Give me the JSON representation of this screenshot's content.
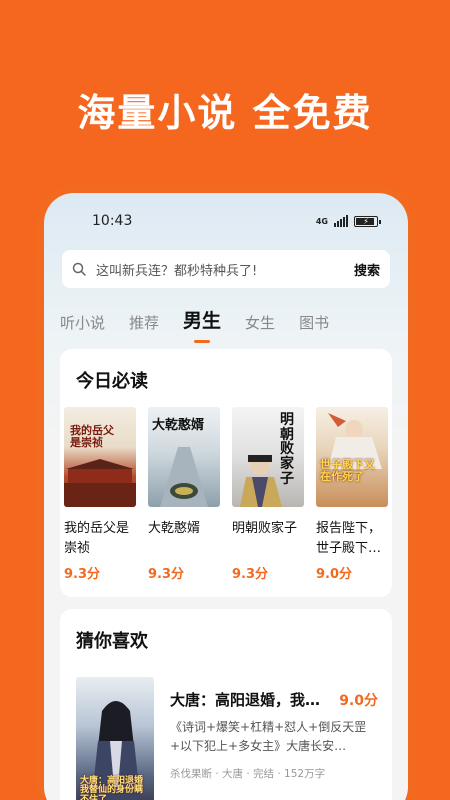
{
  "headline": "海量小说 全免费",
  "status": {
    "time": "10:43",
    "network": "4G"
  },
  "search": {
    "placeholder": "这叫新兵连？都秒特种兵了!",
    "button": "搜索"
  },
  "tabs": [
    {
      "label": "听小说",
      "active": false
    },
    {
      "label": "推荐",
      "active": false
    },
    {
      "label": "男生",
      "active": true
    },
    {
      "label": "女生",
      "active": false
    },
    {
      "label": "图书",
      "active": false
    }
  ],
  "today": {
    "title": "今日必读",
    "books": [
      {
        "title": "我的岳父是崇祯",
        "score": "9.3分",
        "cover_text": "我的岳父是崇祯"
      },
      {
        "title": "大乾憨婿",
        "score": "9.3分",
        "cover_text": "大乾憨婿"
      },
      {
        "title": "明朝败家子",
        "score": "9.3分",
        "cover_text": "明朝败家子"
      },
      {
        "title": "报告陛下，世子殿下…",
        "score": "9.0分",
        "cover_text": "世子殿下又在作死了"
      }
    ]
  },
  "guess": {
    "title": "猜你喜欢",
    "item": {
      "title": "大唐：高阳退婚，我…",
      "score": "9.0分",
      "desc": "《诗词+爆笑+杠精+怼人+倒反天罡+以下犯上+多女主》大唐长安…",
      "meta": "杀伐果断 · 大唐 · 完结 · 152万字",
      "cover_text": "大唐：高阳退婚 我替仙的身份瞒不住了"
    }
  },
  "colors": {
    "accent": "#f26a1f",
    "background": "#f5671f"
  }
}
